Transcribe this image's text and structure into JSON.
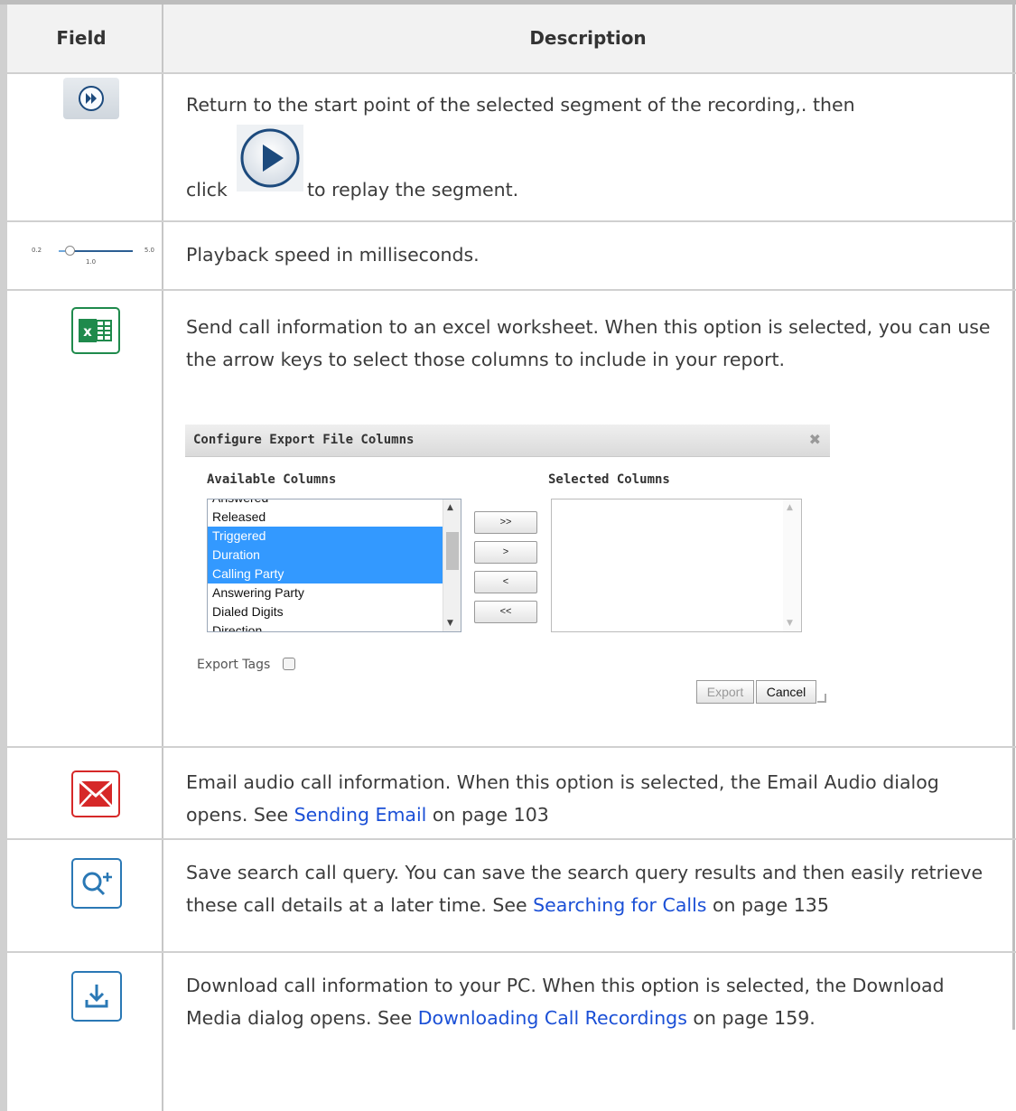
{
  "table": {
    "headers": {
      "field": "Field",
      "description": "Description"
    },
    "rows": [
      {
        "icon": "fast-forward-circle-icon",
        "text_before": "Return to the start point of the selected segment of the recording,. then",
        "text_click": "click",
        "inline_icon": "play-button-icon",
        "text_after": "to replay the segment."
      },
      {
        "icon": "speed-slider-icon",
        "slider": {
          "min_label": "0.2",
          "max_label": "5.0",
          "value_label": "1.0",
          "value": 1.0
        },
        "text": "Playback speed in milliseconds."
      },
      {
        "icon": "excel-icon",
        "text": "Send call information to an excel worksheet. When  this option is selected, you can use the arrow keys to select those columns to include in your report."
      },
      {
        "icon": "email-icon",
        "text_before": "Email audio call information. When this option is selected, the Email Audio dialog opens. See ",
        "link": "Sending Email",
        "text_after": " on page 103"
      },
      {
        "icon": "search-plus-icon",
        "text_before": "Save search call query. You can save the search query results and then easily retrieve these call details at a later time. See ",
        "link": "Searching for Calls",
        "text_after": " on page 135"
      },
      {
        "icon": "download-icon",
        "text_before": "Download call information to your PC. When this option is selected, the Download Media dialog opens. See ",
        "link": "Downloading Call Recordings",
        "text_after": " on page 159."
      }
    ]
  },
  "dialog": {
    "title": "Configure Export File Columns",
    "close_icon": "close-icon",
    "available_label": "Available Columns",
    "selected_label": "Selected Columns",
    "available_items": [
      {
        "label": "Answered",
        "selected": false
      },
      {
        "label": "Released",
        "selected": false
      },
      {
        "label": "Triggered",
        "selected": true
      },
      {
        "label": "Duration",
        "selected": true
      },
      {
        "label": "Calling Party",
        "selected": true
      },
      {
        "label": "Answering Party",
        "selected": false
      },
      {
        "label": "Dialed Digits",
        "selected": false
      },
      {
        "label": "Direction",
        "selected": false
      }
    ],
    "move_buttons": [
      ">>",
      ">",
      "<",
      "<<"
    ],
    "export_tags_label": "Export Tags",
    "export_button": "Export",
    "cancel_button": "Cancel"
  },
  "colors": {
    "link": "#1a4fd6",
    "excel_green": "#1f8a4c",
    "email_red": "#d62828",
    "action_blue": "#2a78b5",
    "selection_blue": "#3399ff"
  }
}
